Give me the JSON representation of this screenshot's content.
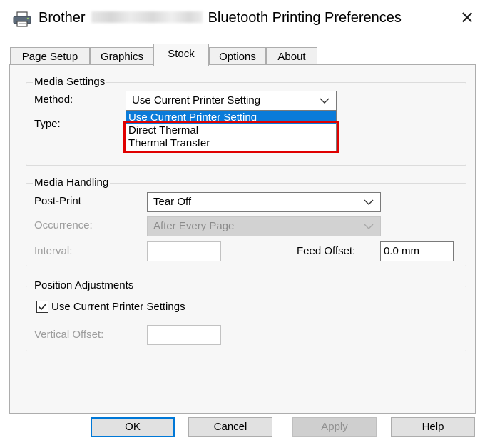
{
  "window": {
    "title_prefix": "Brother",
    "title_suffix": "Bluetooth Printing Preferences",
    "close_symbol": "✕",
    "title_icon": "printer-icon"
  },
  "tabs": [
    {
      "label": "Page Setup",
      "active": false
    },
    {
      "label": "Graphics",
      "active": false
    },
    {
      "label": "Stock",
      "active": true
    },
    {
      "label": "Options",
      "active": false
    },
    {
      "label": "About",
      "active": false
    }
  ],
  "media_settings": {
    "legend": "Media Settings",
    "method_label": "Method:",
    "method_value": "Use Current Printer Setting",
    "type_label": "Type:",
    "dropdown_options": [
      "Use Current Printer Setting",
      "Direct Thermal",
      "Thermal Transfer"
    ],
    "highlight_color": "#e00000"
  },
  "media_handling": {
    "legend": "Media Handling",
    "post_print_label": "Post-Print",
    "post_print_value": "Tear Off",
    "occurrence_label": "Occurrence:",
    "occurrence_value": "After Every Page",
    "interval_label": "Interval:",
    "interval_value": "",
    "feed_offset_label": "Feed Offset:",
    "feed_offset_value": "0.0 mm"
  },
  "position_adjustments": {
    "legend": "Position Adjustments",
    "use_current_label": "Use Current Printer Settings",
    "use_current_checked": true,
    "vertical_offset_label": "Vertical Offset:",
    "vertical_offset_value": ""
  },
  "buttons": {
    "ok": "OK",
    "cancel": "Cancel",
    "apply": "Apply",
    "help": "Help"
  }
}
